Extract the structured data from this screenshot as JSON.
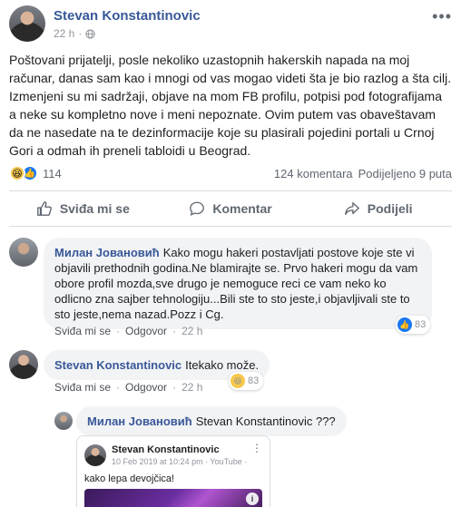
{
  "post": {
    "author": "Stevan Konstantinovic",
    "time": "22 h",
    "dot": "·",
    "text": "Poštovani prijatelji, posle nekoliko uzastopnih hakerskih napada na moj računar, danas sam kao i mnogi od vas mogao videti šta je bio razlog a šta cilj. Izmenjeni su mi sadržaji, objave na mom FB profilu, potpisi pod fotografijama a neke su kompletno nove i meni nepoznate. Ovim putem vas obaveštavam da ne nasedate na te dezinformacije koje su plasirali pojedini portali u Crnoj Gori a odmah ih preneli tabloidi u Beograd.",
    "reactions_count": "114",
    "comments_count": "124 komentara",
    "shares_count": "Podijeljeno 9 puta",
    "icons": [
      "haha-reaction-icon",
      "like-reaction-icon",
      "globe-icon",
      "more-icon"
    ]
  },
  "actions": {
    "like": "Sviđa mi se",
    "comment": "Komentar",
    "share": "Podijeli"
  },
  "comments": [
    {
      "author": "Милан Јовановић",
      "text": "Kako mogu hakeri postavljati postove koje ste vi objavili prethodnih godina.Ne blamirajte se. Prvo hakeri mogu da vam obore profil mozda,sve drugo je nemoguce reci ce vam neko ko odlicno zna sajber tehnologiju...Bili ste to sto jeste,i objavljivali ste to sto jeste,nema nazad.Pozz i Cg.",
      "like": "Sviđa mi se",
      "reply": "Odgovor",
      "time": "22 h",
      "reaction_count": "83"
    },
    {
      "author": "Stevan Konstantinovic",
      "text": "Itekako može.",
      "like": "Sviđa mi se",
      "reply": "Odgovor",
      "time": "22 h",
      "reaction_count": "83"
    },
    {
      "author": "Милан Јовановић",
      "text": "Stevan Konstantinovic ???"
    }
  ],
  "embed": {
    "author": "Stevan Konstantinovic",
    "meta": "10 Feb 2019 at 10:24 pm · YouTube ·",
    "text": "kako lepa devojčica!",
    "info": "i",
    "more": "⋮"
  },
  "colors": {
    "link_blue": "#385898",
    "like_blue": "#1877f2",
    "haha_yellow": "#f7c84b",
    "bubble_gray": "#f2f3f5"
  }
}
